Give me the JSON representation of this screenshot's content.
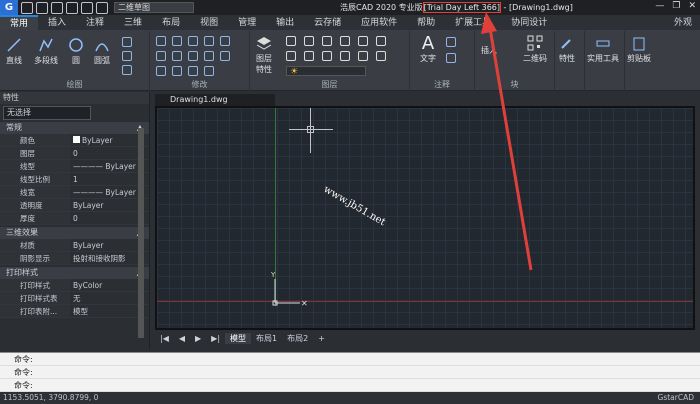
{
  "app": {
    "logo_letter": "G",
    "workspace": "二维草图",
    "title_prefix": "浩辰CAD 2020 专业版",
    "title_trial": "[Trial Day Left 366]",
    "title_suffix": " - [Drawing1.dwg]"
  },
  "tabs": [
    "常用",
    "插入",
    "注释",
    "三维",
    "布局",
    "视图",
    "管理",
    "输出",
    "云存储",
    "应用软件",
    "帮助",
    "扩展工具",
    "协同设计"
  ],
  "tabs_right": "外观",
  "ribbon": {
    "draw": {
      "label": "绘图",
      "line": "直线",
      "polyline": "多段线",
      "circle": "圆",
      "arc": "圆弧"
    },
    "modify": {
      "label": "修改"
    },
    "layer": {
      "label": "图层",
      "props": "图层",
      "props2": "特性"
    },
    "annotation": {
      "label": "注释",
      "text": "文字"
    },
    "block": {
      "label": "块",
      "insert": "插入",
      "qr": "二维码"
    },
    "properties": "特性",
    "utilities": "实用工具",
    "clipboard": "剪贴板"
  },
  "props": {
    "header": "特性",
    "selection": "无选择",
    "sections": [
      {
        "title": "常规",
        "rows": [
          [
            "颜色",
            "ByLayer"
          ],
          [
            "图层",
            "0"
          ],
          [
            "线型",
            "———— ByLayer"
          ],
          [
            "线型比例",
            "1"
          ],
          [
            "线宽",
            "———— ByLayer"
          ],
          [
            "透明度",
            "ByLayer"
          ],
          [
            "厚度",
            "0"
          ]
        ]
      },
      {
        "title": "三维效果",
        "rows": [
          [
            "材质",
            "ByLayer"
          ],
          [
            "阴影显示",
            "投射和接收阴影"
          ]
        ]
      },
      {
        "title": "打印样式",
        "rows": [
          [
            "打印样式",
            "ByColor"
          ],
          [
            "打印样式表",
            "无"
          ],
          [
            "打印表附...",
            "模型"
          ]
        ]
      }
    ]
  },
  "doc_tab": "Drawing1.dwg",
  "watermark": "www.jb51.net",
  "ucs": {
    "y": "Y"
  },
  "layout_tabs": [
    "模型",
    "布局1",
    "布局2"
  ],
  "command_lines": [
    "命令:",
    "命令:",
    "命令:"
  ],
  "status": {
    "coords": "1153.5051, 3790.8799, 0",
    "right": "GstarCAD"
  },
  "colors": {
    "accent": "#2a85d8",
    "annotation_red": "#e0403a"
  }
}
